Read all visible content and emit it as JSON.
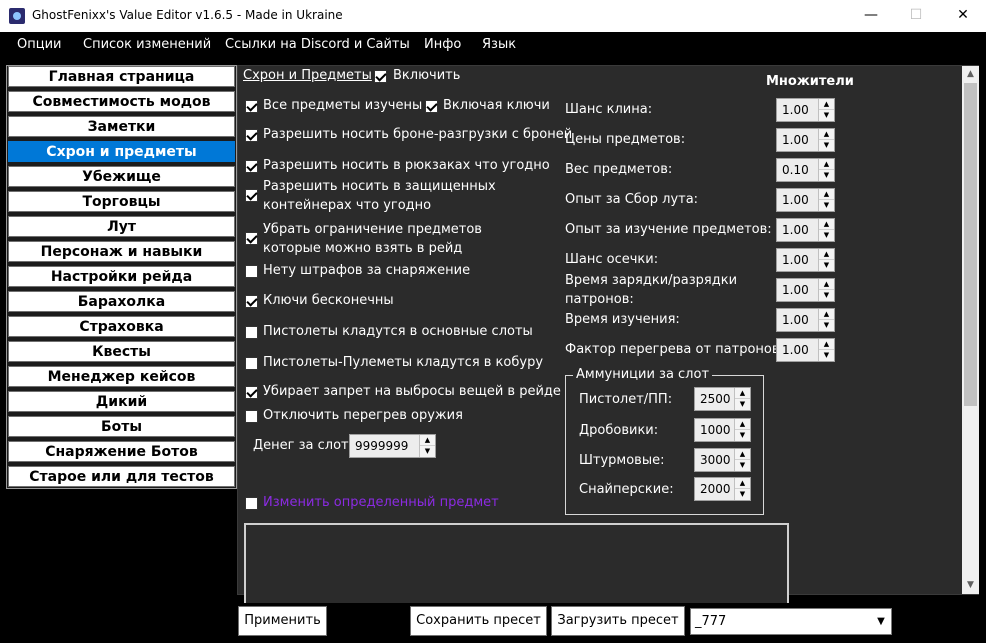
{
  "window": {
    "title": "GhostFenixx's Value Editor v1.6.5 - Made in Ukraine",
    "minimize_glyph": "—",
    "maximize_glyph": "☐",
    "close_glyph": "✕"
  },
  "menu": {
    "items": [
      "Опции",
      "Список изменений",
      "Ссылки на Discord и Сайты",
      "Инфо",
      "Язык"
    ]
  },
  "sidebar": {
    "items": [
      {
        "label": "Главная страница",
        "active": false
      },
      {
        "label": "Совместимость модов",
        "active": false
      },
      {
        "label": "Заметки",
        "active": false
      },
      {
        "label": "Схрон и предметы",
        "active": true
      },
      {
        "label": "Убежище",
        "active": false
      },
      {
        "label": "Торговцы",
        "active": false
      },
      {
        "label": "Лут",
        "active": false
      },
      {
        "label": "Персонаж и навыки",
        "active": false
      },
      {
        "label": "Настройки рейда",
        "active": false
      },
      {
        "label": "Барахолка",
        "active": false
      },
      {
        "label": "Страховка",
        "active": false
      },
      {
        "label": "Квесты",
        "active": false
      },
      {
        "label": "Менеджер кейсов",
        "active": false
      },
      {
        "label": "Дикий",
        "active": false
      },
      {
        "label": "Боты",
        "active": false
      },
      {
        "label": "Снаряжение Ботов",
        "active": false
      },
      {
        "label": "Старое или для тестов",
        "active": false
      }
    ]
  },
  "section": {
    "title": "Схрон и Предметы",
    "enable_label": "Включить",
    "enable_checked": true
  },
  "options": [
    {
      "label": "Все предметы изучены",
      "checked": true
    },
    {
      "label": "Включая ключи",
      "checked": true
    },
    {
      "label": "Разрешить носить броне-разгрузки с броней",
      "checked": true
    },
    {
      "label": "Разрешить носить в рюкзаках что угодно",
      "checked": true
    },
    {
      "label": "Разрешить носить в защищенных контейнерах что угодно",
      "checked": true
    },
    {
      "label": "Убрать ограничение предметов которые можно взять в рейд",
      "checked": true
    },
    {
      "label": "Нету штрафов за снаряжение",
      "checked": false
    },
    {
      "label": "Ключи бесконечны",
      "checked": true
    },
    {
      "label": "Пистолеты кладутся в основные слоты",
      "checked": false
    },
    {
      "label": "Пистолеты-Пулеметы кладутся в кобуру",
      "checked": false
    },
    {
      "label": "Убирает запрет на выбросы вещей в рейде",
      "checked": true
    },
    {
      "label": "Отключить перегрев оружия",
      "checked": false
    }
  ],
  "money_per_slot": {
    "label": "Денег за слот:",
    "value": "9999999"
  },
  "change_item": {
    "label": "Изменить определенный предмет",
    "checked": false,
    "color": "#8b2be2"
  },
  "multipliers": {
    "heading": "Множители",
    "rows": [
      {
        "label": "Шанс клина:",
        "value": "1.00"
      },
      {
        "label": "Цены предметов:",
        "value": "1.00"
      },
      {
        "label": "Вес предметов:",
        "value": "0.10"
      },
      {
        "label": "Опыт за Сбор лута:",
        "value": "1.00"
      },
      {
        "label": "Опыт за изучение предметов:",
        "value": "1.00"
      },
      {
        "label": "Шанс осечки:",
        "value": "1.00"
      },
      {
        "label": "Время зарядки/разрядки патронов:",
        "value": "1.00"
      },
      {
        "label": "Время изучения:",
        "value": "1.00"
      },
      {
        "label": "Фактор перегрева от патронов:",
        "value": "1.00"
      }
    ]
  },
  "ammo": {
    "legend": "Аммуниции за слот",
    "rows": [
      {
        "label": "Пистолет/ПП:",
        "value": "2500"
      },
      {
        "label": "Дробовики:",
        "value": "1000"
      },
      {
        "label": "Штурмовые:",
        "value": "3000"
      },
      {
        "label": "Снайперские:",
        "value": "2000"
      }
    ]
  },
  "bottom": {
    "apply_label": "Применить",
    "save_preset_label": "Сохранить пресет",
    "load_preset_label": "Загрузить пресет",
    "preset_value": "_777"
  },
  "colors": {
    "accent": "#0078d7",
    "panel": "#2b2b2b",
    "background": "#000000"
  }
}
